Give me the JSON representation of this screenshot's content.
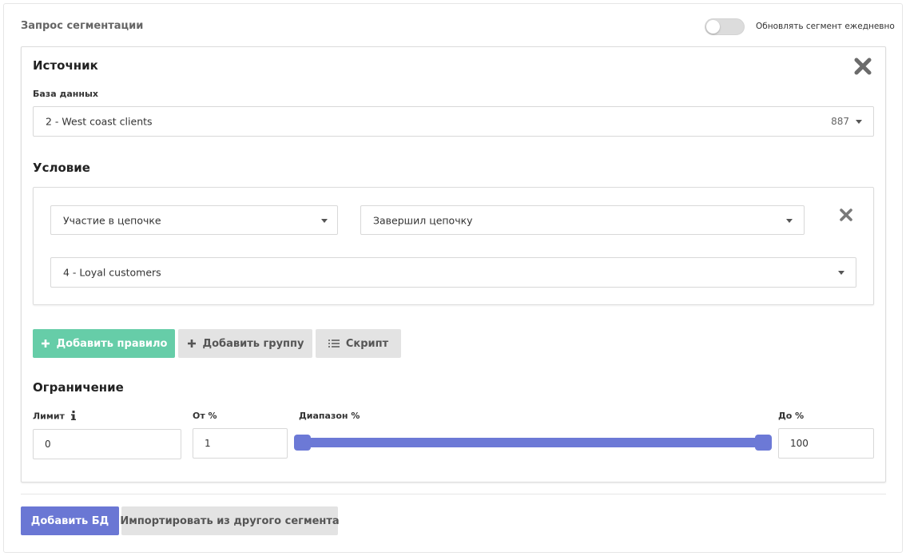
{
  "header": {
    "title": "Запрос сегментации",
    "toggle_label": "Обновлять сегмент ежедневно",
    "toggle_on": false
  },
  "source": {
    "title": "Источник",
    "db_label": "База данных",
    "db_value": "2 - West coast clients",
    "db_count": "887"
  },
  "condition": {
    "title": "Условие",
    "rule_type": "Участие в цепочке",
    "rule_state": "Завершил цепочку",
    "rule_target": "4 - Loyal customers"
  },
  "actions": {
    "add_rule": "Добавить правило",
    "add_group": "Добавить группу",
    "script": "Скрипт"
  },
  "limit": {
    "title": "Ограничение",
    "limit_label": "Лимит",
    "limit_value": "0",
    "from_label": "От %",
    "from_value": "1",
    "range_label": "Диапазон %",
    "to_label": "До %",
    "to_value": "100",
    "range_min": 1,
    "range_max": 100
  },
  "footer": {
    "add_db": "Добавить БД",
    "import": "Импортировать из другого сегмента"
  },
  "colors": {
    "accent": "#6a77d4",
    "green": "#66cda8",
    "gray_button": "#e3e3e3"
  }
}
